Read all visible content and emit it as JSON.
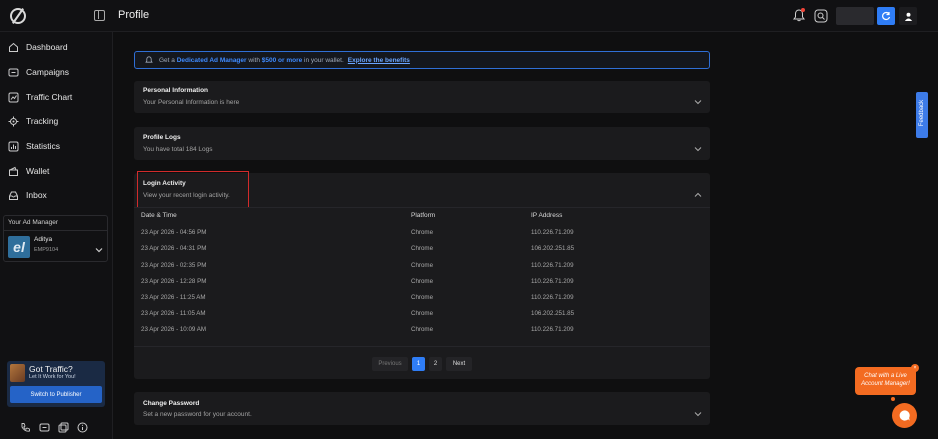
{
  "header": {
    "title": "Profile"
  },
  "sidebar": {
    "items": [
      {
        "label": "Dashboard",
        "icon": "home-icon"
      },
      {
        "label": "Campaigns",
        "icon": "campaign-icon"
      },
      {
        "label": "Traffic Chart",
        "icon": "chart-icon"
      },
      {
        "label": "Tracking",
        "icon": "tracking-icon"
      },
      {
        "label": "Statistics",
        "icon": "statistics-icon"
      },
      {
        "label": "Wallet",
        "icon": "wallet-icon"
      },
      {
        "label": "Inbox",
        "icon": "inbox-icon"
      }
    ],
    "ad_manager": {
      "title": "Your Ad Manager",
      "name": "Aditya",
      "code": "EMP9104"
    },
    "promo": {
      "title": "Got Traffic?",
      "subtitle": "Let It Work for You!",
      "button": "Switch to Publisher"
    }
  },
  "banner": {
    "prefix": "Get a",
    "highlight": "Dedicated Ad Manager",
    "middle": "with",
    "amount": "$500 or more",
    "suffix": "in your wallet.",
    "link": "Explore the benefits"
  },
  "sections": {
    "personal": {
      "title": "Personal Information",
      "subtitle": "Your Personal Information is here"
    },
    "logs": {
      "title": "Profile Logs",
      "subtitle": "You have total 184 Logs"
    },
    "login": {
      "title": "Login Activity",
      "subtitle": "View your recent login activity."
    },
    "password": {
      "title": "Change Password",
      "subtitle": "Set a new password for your account."
    }
  },
  "table": {
    "headers": [
      "Date & Time",
      "Platform",
      "IP Address"
    ],
    "rows": [
      [
        "23 Apr 2026 - 04:56 PM",
        "Chrome",
        "110.226.71.209"
      ],
      [
        "23 Apr 2026 - 04:31 PM",
        "Chrome",
        "106.202.251.85"
      ],
      [
        "23 Apr 2026 - 02:35 PM",
        "Chrome",
        "110.226.71.209"
      ],
      [
        "23 Apr 2026 - 12:28 PM",
        "Chrome",
        "110.226.71.209"
      ],
      [
        "23 Apr 2026 - 11:25 AM",
        "Chrome",
        "110.226.71.209"
      ],
      [
        "23 Apr 2026 - 11:05 AM",
        "Chrome",
        "106.202.251.85"
      ],
      [
        "23 Apr 2026 - 10:09 AM",
        "Chrome",
        "110.226.71.209"
      ]
    ]
  },
  "pagination": {
    "prev": "Previous",
    "pages": [
      "1",
      "2"
    ],
    "next": "Next"
  },
  "feedback": {
    "label": "Feedback"
  },
  "chat": {
    "line1": "Chat with a Live",
    "line2": "Account Manager!",
    "close": "×"
  },
  "colors": {
    "accent": "#2f7df6",
    "chat": "#f36b21",
    "highlight_border": "#d12b2b"
  }
}
